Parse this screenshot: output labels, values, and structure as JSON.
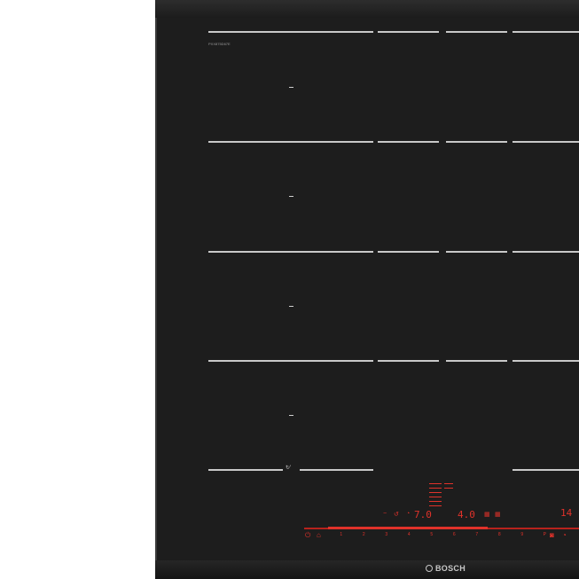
{
  "model_label": "PXX875D67E",
  "brand": "BOSCH",
  "zones": [
    {
      "name": "zone-1"
    },
    {
      "name": "zone-2"
    },
    {
      "name": "zone-3"
    },
    {
      "name": "zone-4"
    },
    {
      "name": "zone-5"
    }
  ],
  "flex_symbol": "↻′",
  "display": {
    "left_value": "7.0",
    "mid_value": "4.0",
    "right_value": "14",
    "minus_symbol": "−",
    "timer_icon": "clock-icon",
    "power_icon": "power-icon"
  },
  "power_levels": [
    "1",
    "2",
    "3",
    "4",
    "5",
    "6",
    "7",
    "8",
    "9",
    "P"
  ],
  "colors": {
    "glass": "#1d1d1d",
    "zone_marking": "#c9c9c9",
    "display_red": "#e0322a"
  }
}
